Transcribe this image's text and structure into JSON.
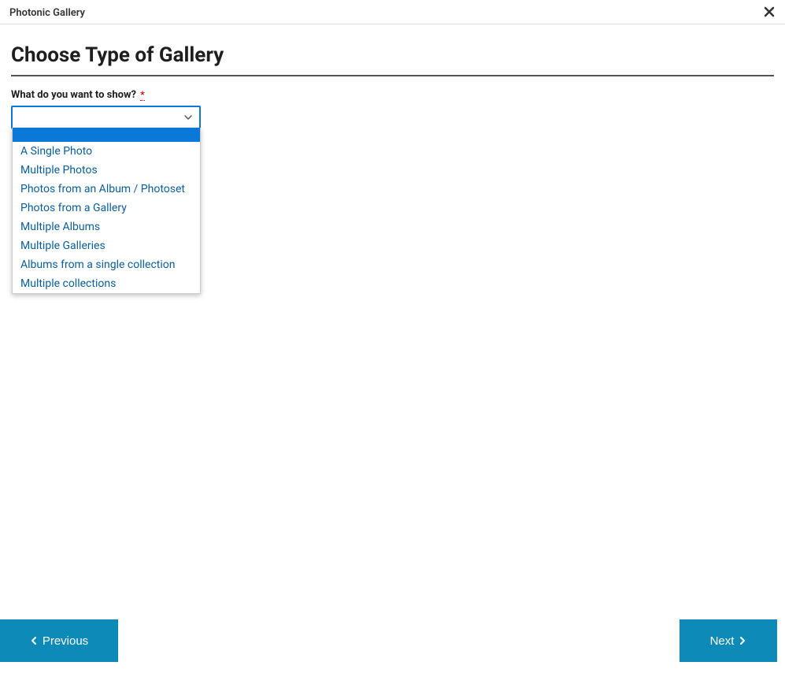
{
  "header": {
    "title": "Photonic Gallery"
  },
  "page": {
    "title": "Choose Type of Gallery"
  },
  "field": {
    "label": "What do you want to show?",
    "required_mark": "*",
    "selected_value": "",
    "options": [
      "",
      "A Single Photo",
      "Multiple Photos",
      "Photos from an Album / Photoset",
      "Photos from a Gallery",
      "Multiple Albums",
      "Multiple Galleries",
      "Albums from a single collection",
      "Multiple collections"
    ]
  },
  "footer": {
    "previous_label": "Previous",
    "next_label": "Next"
  },
  "colors": {
    "accent": "#0a78d6",
    "button": "#0d8ab7",
    "link": "#0a5d9c",
    "required": "#cc0000"
  }
}
